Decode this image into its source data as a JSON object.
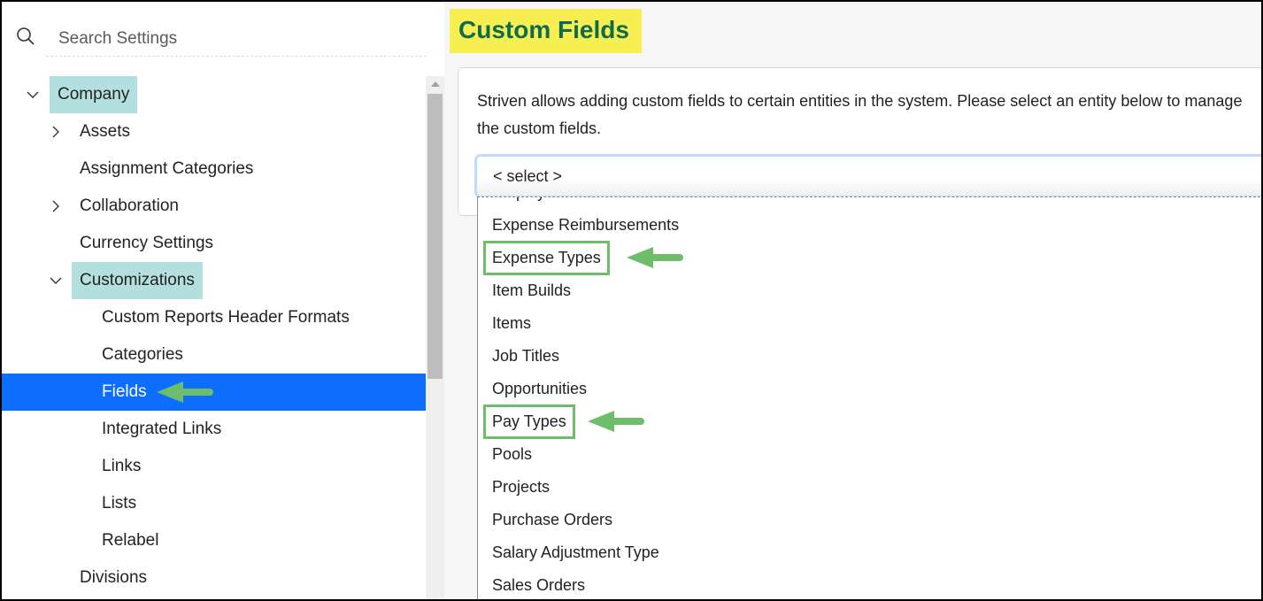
{
  "sidebar": {
    "search_placeholder": "Search Settings",
    "tree": [
      {
        "label": "Company",
        "level": 0,
        "expander": "expanded",
        "highlighted": true
      },
      {
        "label": "Assets",
        "level": 1,
        "expander": "collapsed"
      },
      {
        "label": "Assignment Categories",
        "level": 1,
        "expander": "none"
      },
      {
        "label": "Collaboration",
        "level": 1,
        "expander": "collapsed"
      },
      {
        "label": "Currency Settings",
        "level": 1,
        "expander": "none"
      },
      {
        "label": "Customizations",
        "level": 1,
        "expander": "expanded",
        "highlighted": true
      },
      {
        "label": "Custom Reports Header Formats",
        "level": 2,
        "expander": "none"
      },
      {
        "label": "Categories",
        "level": 2,
        "expander": "none"
      },
      {
        "label": "Fields",
        "level": 2,
        "expander": "none",
        "selected": true,
        "annotated_arrow": true
      },
      {
        "label": "Integrated Links",
        "level": 2,
        "expander": "none"
      },
      {
        "label": "Links",
        "level": 2,
        "expander": "none"
      },
      {
        "label": "Lists",
        "level": 2,
        "expander": "none"
      },
      {
        "label": "Relabel",
        "level": 2,
        "expander": "none"
      },
      {
        "label": "Divisions",
        "level": 1,
        "expander": "none"
      }
    ]
  },
  "main": {
    "title": "Custom Fields",
    "description": "Striven allows adding custom fields to certain entities in the system. Please select an entity below to manage the custom fields.",
    "entity_select": {
      "value": "< select >",
      "options_visible": [
        {
          "label": "Expense Reimbursements"
        },
        {
          "label": "Expense Types",
          "annotated": true
        },
        {
          "label": "Item Builds"
        },
        {
          "label": "Items"
        },
        {
          "label": "Job Titles"
        },
        {
          "label": "Opportunities"
        },
        {
          "label": "Pay Types",
          "annotated": true
        },
        {
          "label": "Pools"
        },
        {
          "label": "Projects"
        },
        {
          "label": "Purchase Orders"
        },
        {
          "label": "Salary Adjustment Type"
        },
        {
          "label": "Sales Orders"
        }
      ]
    }
  },
  "colors": {
    "selected_bg": "#0d6efd",
    "highlight_bg": "#b3e0df",
    "title_highlight": "#f7ef52",
    "title_text": "#0f6b4f",
    "annotation_green": "#6dbd6a",
    "select_focus": "#c3d9fb"
  }
}
